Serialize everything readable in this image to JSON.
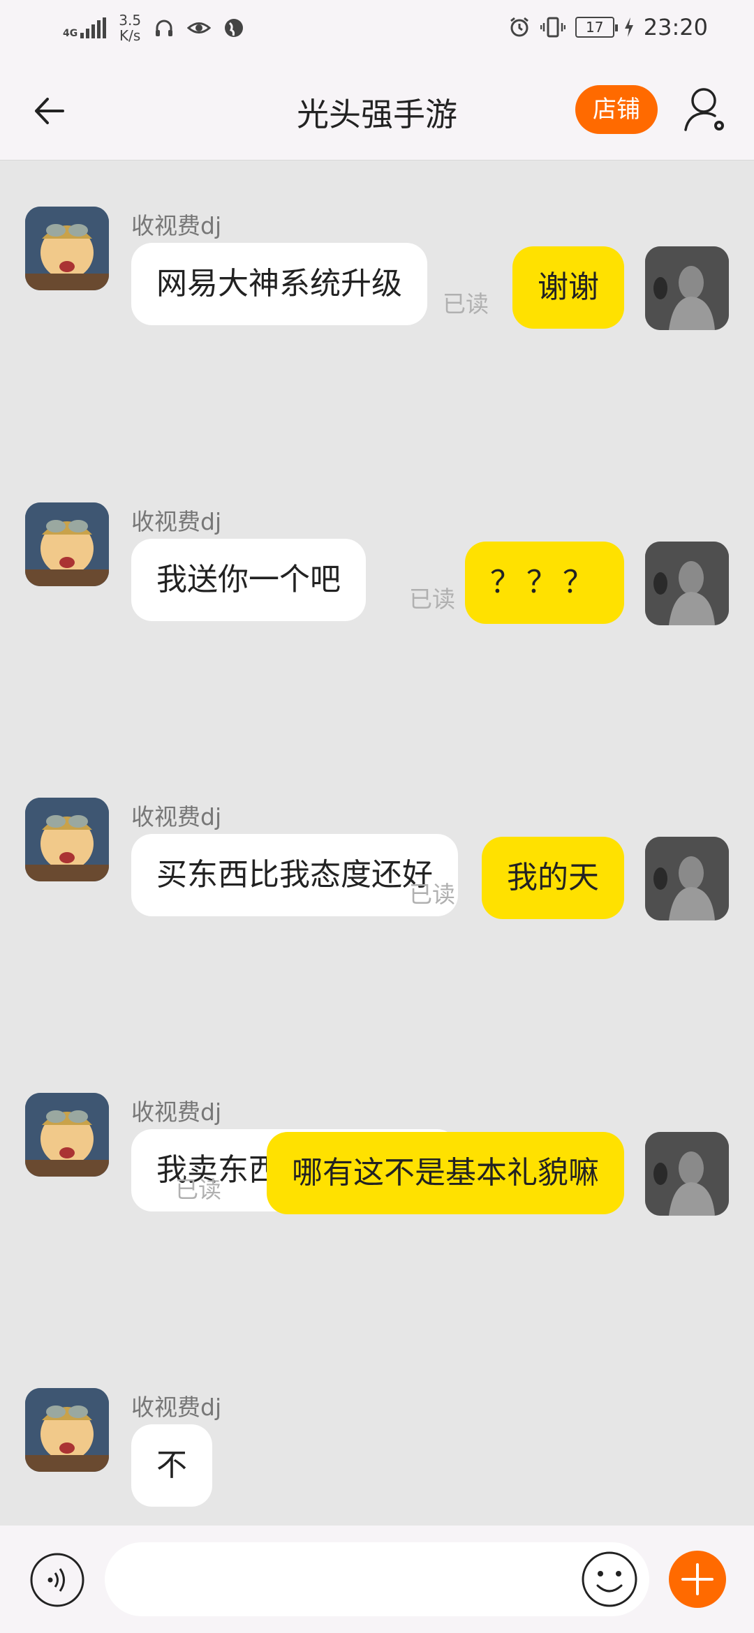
{
  "status_bar": {
    "network": "4G",
    "speed_value": "3.5",
    "speed_unit": "K/s",
    "battery": "17",
    "time": "23:20"
  },
  "header": {
    "title": "光头强手游",
    "shop_label": "店铺",
    "icons": [
      "back-arrow-icon",
      "user-settings-icon"
    ]
  },
  "messages": [
    {
      "from": "other",
      "name": "收视费dj",
      "text": "网易大神系统升级"
    },
    {
      "from": "self",
      "text": "谢谢",
      "read": "已读"
    },
    {
      "from": "other",
      "name": "收视费dj",
      "text": "我送你一个吧"
    },
    {
      "from": "self",
      "text": "？？？",
      "read": "已读"
    },
    {
      "from": "other",
      "name": "收视费dj",
      "text": "买东西比我态度还好"
    },
    {
      "from": "self",
      "text": "我的天",
      "read": "已读"
    },
    {
      "from": "other",
      "name": "收视费dj",
      "text": "我卖东西都不用您的"
    },
    {
      "from": "self",
      "text": "哪有这不是基本礼貌嘛",
      "read": "已读"
    },
    {
      "from": "other",
      "name": "收视费dj",
      "text": "不"
    }
  ],
  "input_bar": {
    "placeholder": "",
    "icons": [
      "voice-icon",
      "emoji-icon",
      "plus-icon"
    ]
  },
  "colors": {
    "accent": "#ff6a00",
    "self_bubble": "#ffe100",
    "other_bubble": "#ffffff",
    "chat_bg": "#e6e6e6"
  }
}
